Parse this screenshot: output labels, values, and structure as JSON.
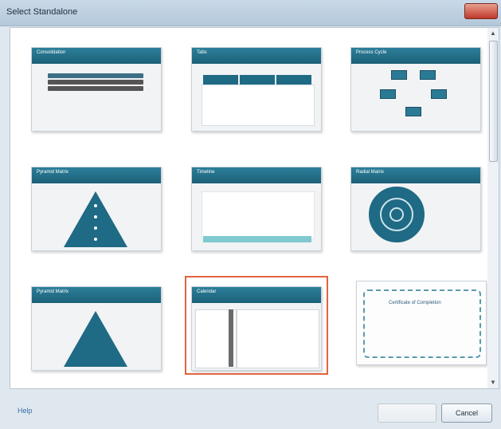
{
  "window": {
    "title": "Select Standalone"
  },
  "tiles": [
    {
      "title": "Consolidation",
      "subtitle": ""
    },
    {
      "title": "Tabs",
      "subtitle": "",
      "tabs": [
        "",
        "",
        ""
      ]
    },
    {
      "title": "Process Cycle",
      "subtitle": ""
    },
    {
      "title": "Pyramid Matrix",
      "subtitle": ""
    },
    {
      "title": "Timeline",
      "subtitle": ""
    },
    {
      "title": "Radial Matrix",
      "subtitle": ""
    },
    {
      "title": "Pyramid Matrix",
      "subtitle": ""
    },
    {
      "title": "Calendar",
      "subtitle": ""
    },
    {
      "title": "Certificate of Completion",
      "subtitle": ""
    }
  ],
  "footer": {
    "help_label": "Help",
    "insert_label": "",
    "cancel_label": "Cancel"
  }
}
